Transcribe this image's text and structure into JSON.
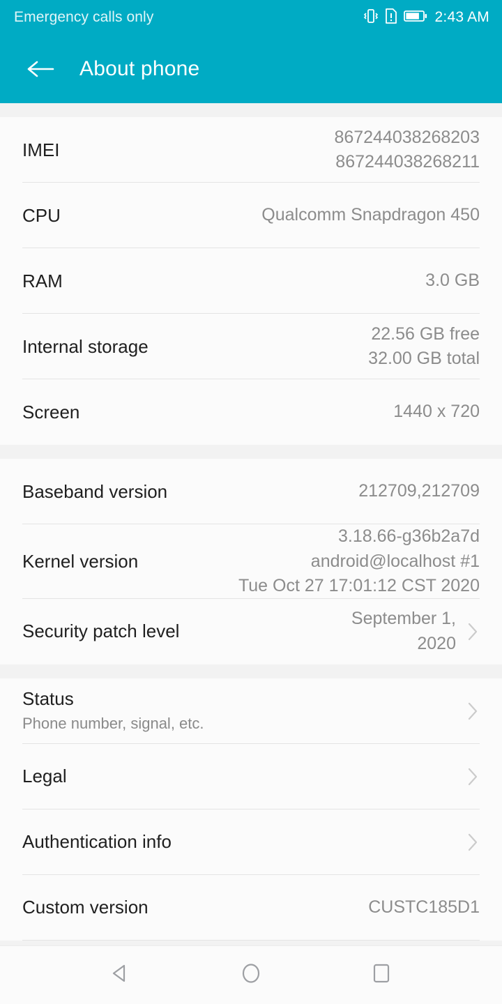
{
  "statusbar": {
    "carrier": "Emergency calls only",
    "time": "2:43 AM",
    "icons": [
      "vibrate-icon",
      "sim-alert-icon",
      "battery-icon"
    ]
  },
  "appbar": {
    "title": "About phone",
    "back_icon": "back-arrow-icon"
  },
  "colors": {
    "accent": "#00abc4",
    "page_background": "#fbfbfb",
    "section_gap": "#f2f2f2",
    "divider": "#e4e4e4",
    "label": "#1f1f1f",
    "value": "#8c8c8c",
    "chevron": "#cccccc"
  },
  "sections": [
    {
      "name": "hardware",
      "rows": [
        {
          "label": "IMEI",
          "value": "867244038268203\n867244038268211",
          "chevron": false
        },
        {
          "label": "CPU",
          "value": "Qualcomm Snapdragon 450",
          "chevron": false
        },
        {
          "label": "RAM",
          "value": "3.0 GB",
          "chevron": false
        },
        {
          "label": "Internal storage",
          "value": "22.56  GB free\n32.00  GB total",
          "chevron": false
        },
        {
          "label": "Screen",
          "value": "1440 x 720",
          "chevron": false
        }
      ]
    },
    {
      "name": "software",
      "rows": [
        {
          "label": "Baseband version",
          "value": "212709,212709",
          "chevron": false
        },
        {
          "label": "Kernel version",
          "value": "3.18.66-g36b2a7d\nandroid@localhost #1\nTue Oct 27 17:01:12 CST 2020",
          "chevron": false
        },
        {
          "label": "Security patch level",
          "value": "September 1, 2020",
          "chevron": true
        }
      ]
    },
    {
      "name": "links",
      "rows": [
        {
          "label": "Status",
          "sub": "Phone number, signal, etc.",
          "value": "",
          "chevron": true
        },
        {
          "label": "Legal",
          "value": "",
          "chevron": true
        },
        {
          "label": "Authentication info",
          "value": "",
          "chevron": true
        },
        {
          "label": "Custom version",
          "value": "CUSTC185D1",
          "chevron": false
        }
      ]
    }
  ],
  "navbar": {
    "back_label": "back-nav-icon",
    "home_label": "home-nav-icon",
    "recents_label": "recents-nav-icon"
  }
}
